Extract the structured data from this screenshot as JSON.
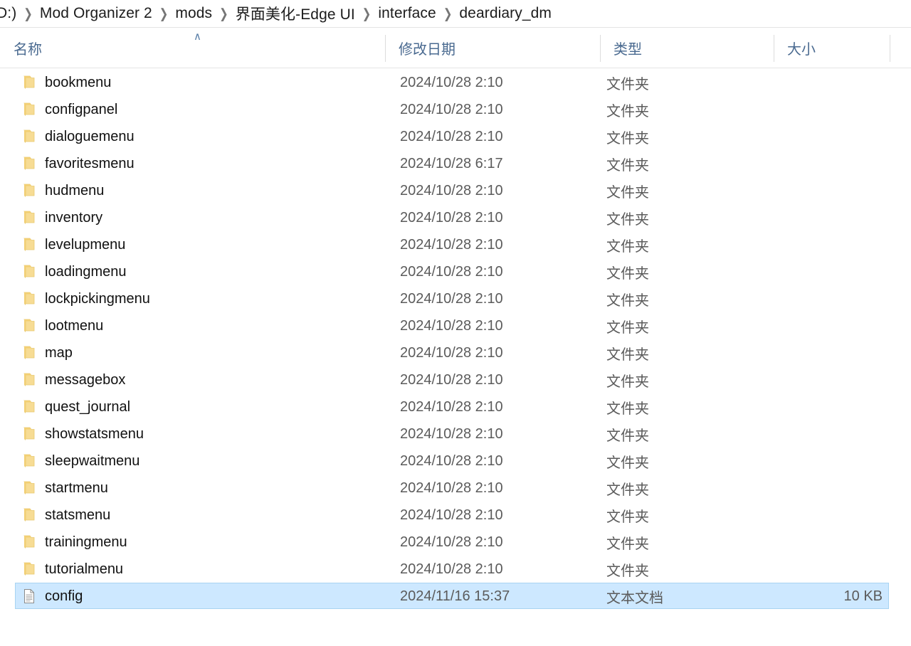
{
  "window": {
    "app": "file-explorer"
  },
  "breadcrumb": {
    "separator": "❯",
    "items": [
      {
        "label": "D:)"
      },
      {
        "label": "Mod Organizer 2"
      },
      {
        "label": "mods"
      },
      {
        "label": "界面美化-Edge UI"
      },
      {
        "label": "interface"
      },
      {
        "label": "deardiary_dm"
      }
    ]
  },
  "columns": {
    "sort_column": "名称",
    "sort_direction": "ascending",
    "sort_glyph": "∧",
    "headers": [
      {
        "label": "名称"
      },
      {
        "label": "修改日期"
      },
      {
        "label": "类型"
      },
      {
        "label": "大小"
      }
    ]
  },
  "colors": {
    "selection_fill": "#cde8ff",
    "selection_border": "#a8d4f2",
    "header_text": "#4a6a90",
    "folder_icon": "#f5d98a",
    "secondary_text": "#5b5b5b"
  },
  "files": {
    "rows": [
      {
        "icon": "folder-icon",
        "name": "bookmenu",
        "date": "2024/10/28 2:10",
        "type": "文件夹",
        "size": "",
        "selected": false
      },
      {
        "icon": "folder-icon",
        "name": "configpanel",
        "date": "2024/10/28 2:10",
        "type": "文件夹",
        "size": "",
        "selected": false
      },
      {
        "icon": "folder-icon",
        "name": "dialoguemenu",
        "date": "2024/10/28 2:10",
        "type": "文件夹",
        "size": "",
        "selected": false
      },
      {
        "icon": "folder-icon",
        "name": "favoritesmenu",
        "date": "2024/10/28 6:17",
        "type": "文件夹",
        "size": "",
        "selected": false
      },
      {
        "icon": "folder-icon",
        "name": "hudmenu",
        "date": "2024/10/28 2:10",
        "type": "文件夹",
        "size": "",
        "selected": false
      },
      {
        "icon": "folder-icon",
        "name": "inventory",
        "date": "2024/10/28 2:10",
        "type": "文件夹",
        "size": "",
        "selected": false
      },
      {
        "icon": "folder-icon",
        "name": "levelupmenu",
        "date": "2024/10/28 2:10",
        "type": "文件夹",
        "size": "",
        "selected": false
      },
      {
        "icon": "folder-icon",
        "name": "loadingmenu",
        "date": "2024/10/28 2:10",
        "type": "文件夹",
        "size": "",
        "selected": false
      },
      {
        "icon": "folder-icon",
        "name": "lockpickingmenu",
        "date": "2024/10/28 2:10",
        "type": "文件夹",
        "size": "",
        "selected": false
      },
      {
        "icon": "folder-icon",
        "name": "lootmenu",
        "date": "2024/10/28 2:10",
        "type": "文件夹",
        "size": "",
        "selected": false
      },
      {
        "icon": "folder-icon",
        "name": "map",
        "date": "2024/10/28 2:10",
        "type": "文件夹",
        "size": "",
        "selected": false
      },
      {
        "icon": "folder-icon",
        "name": "messagebox",
        "date": "2024/10/28 2:10",
        "type": "文件夹",
        "size": "",
        "selected": false
      },
      {
        "icon": "folder-icon",
        "name": "quest_journal",
        "date": "2024/10/28 2:10",
        "type": "文件夹",
        "size": "",
        "selected": false
      },
      {
        "icon": "folder-icon",
        "name": "showstatsmenu",
        "date": "2024/10/28 2:10",
        "type": "文件夹",
        "size": "",
        "selected": false
      },
      {
        "icon": "folder-icon",
        "name": "sleepwaitmenu",
        "date": "2024/10/28 2:10",
        "type": "文件夹",
        "size": "",
        "selected": false
      },
      {
        "icon": "folder-icon",
        "name": "startmenu",
        "date": "2024/10/28 2:10",
        "type": "文件夹",
        "size": "",
        "selected": false
      },
      {
        "icon": "folder-icon",
        "name": "statsmenu",
        "date": "2024/10/28 2:10",
        "type": "文件夹",
        "size": "",
        "selected": false
      },
      {
        "icon": "folder-icon",
        "name": "trainingmenu",
        "date": "2024/10/28 2:10",
        "type": "文件夹",
        "size": "",
        "selected": false
      },
      {
        "icon": "folder-icon",
        "name": "tutorialmenu",
        "date": "2024/10/28 2:10",
        "type": "文件夹",
        "size": "",
        "selected": false
      },
      {
        "icon": "text-document-icon",
        "name": "config",
        "date": "2024/11/16 15:37",
        "type": "文本文档",
        "size": "10 KB",
        "selected": true
      }
    ]
  }
}
